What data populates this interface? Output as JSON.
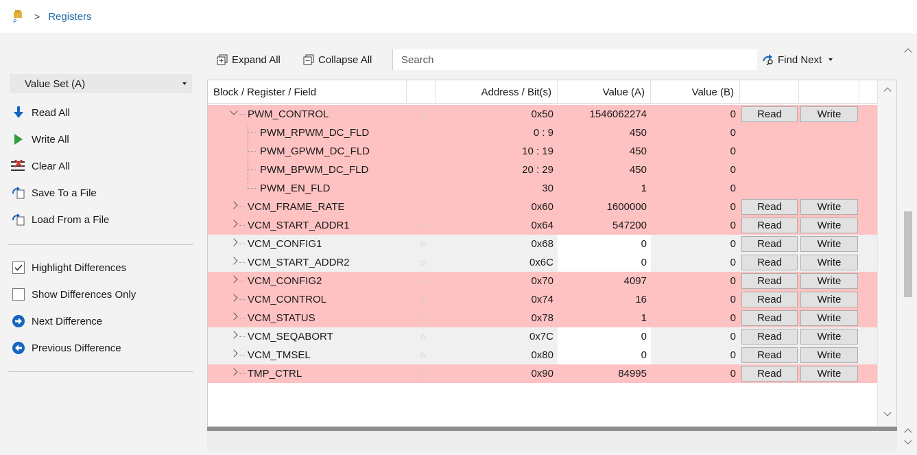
{
  "breadcrumb": {
    "label": "Registers"
  },
  "left_panel": {
    "value_set": "Value Set (A)",
    "actions": [
      {
        "label": "Read All",
        "icon": "arrow-down-icon"
      },
      {
        "label": "Write All",
        "icon": "play-icon"
      },
      {
        "label": "Clear All",
        "icon": "clear-list-icon"
      },
      {
        "label": "Save To a File",
        "icon": "save-file-icon"
      },
      {
        "label": "Load From a File",
        "icon": "load-file-icon"
      }
    ],
    "options": [
      {
        "label": "Highlight Differences",
        "checked": true
      },
      {
        "label": "Show Differences Only",
        "checked": false
      }
    ],
    "nav": [
      {
        "label": "Next Difference",
        "icon": "arrow-right-circle-icon"
      },
      {
        "label": "Previous Difference",
        "icon": "arrow-left-circle-icon"
      }
    ]
  },
  "toolbar": {
    "expand_all": "Expand All",
    "collapse_all": "Collapse All",
    "search_placeholder": "Search",
    "find_next": "Find Next"
  },
  "table": {
    "headers": [
      "Block / Register / Field",
      "",
      "Address / Bit(s)",
      "Value (A)",
      "Value (B)",
      "",
      ""
    ],
    "rows": [
      {
        "name": "PWM_CONTROL",
        "level": 0,
        "expanded": true,
        "star": true,
        "addr": "0x50",
        "va": "1546062274",
        "vb": "0",
        "diff": true,
        "buttons": true
      },
      {
        "name": "PWM_RPWM_DC_FLD",
        "level": 1,
        "star": false,
        "addr": "0 : 9",
        "va": "450",
        "vb": "0",
        "diff": true,
        "buttons": false
      },
      {
        "name": "PWM_GPWM_DC_FLD",
        "level": 1,
        "star": false,
        "addr": "10 : 19",
        "va": "450",
        "vb": "0",
        "diff": true,
        "buttons": false
      },
      {
        "name": "PWM_BPWM_DC_FLD",
        "level": 1,
        "star": false,
        "addr": "20 : 29",
        "va": "450",
        "vb": "0",
        "diff": true,
        "buttons": false
      },
      {
        "name": "PWM_EN_FLD",
        "level": 1,
        "last": true,
        "star": false,
        "addr": "30",
        "va": "1",
        "vb": "0",
        "diff": true,
        "buttons": false
      },
      {
        "name": "VCM_FRAME_RATE",
        "level": 0,
        "star": true,
        "addr": "0x60",
        "va": "1600000",
        "vb": "0",
        "diff": true,
        "buttons": true
      },
      {
        "name": "VCM_START_ADDR1",
        "level": 0,
        "star": true,
        "addr": "0x64",
        "va": "547200",
        "vb": "0",
        "diff": true,
        "buttons": true
      },
      {
        "name": "VCM_CONFIG1",
        "level": 0,
        "star": true,
        "addr": "0x68",
        "va": "0",
        "vb": "0",
        "diff": false,
        "buttons": true
      },
      {
        "name": "VCM_START_ADDR2",
        "level": 0,
        "star": true,
        "addr": "0x6C",
        "va": "0",
        "vb": "0",
        "diff": false,
        "buttons": true
      },
      {
        "name": "VCM_CONFIG2",
        "level": 0,
        "star": true,
        "addr": "0x70",
        "va": "4097",
        "vb": "0",
        "diff": true,
        "buttons": true
      },
      {
        "name": "VCM_CONTROL",
        "level": 0,
        "star": true,
        "addr": "0x74",
        "va": "16",
        "vb": "0",
        "diff": true,
        "buttons": true
      },
      {
        "name": "VCM_STATUS",
        "level": 0,
        "star": true,
        "addr": "0x78",
        "va": "1",
        "vb": "0",
        "diff": true,
        "buttons": true
      },
      {
        "name": "VCM_SEQABORT",
        "level": 0,
        "star": true,
        "addr": "0x7C",
        "va": "0",
        "vb": "0",
        "diff": false,
        "buttons": true
      },
      {
        "name": "VCM_TMSEL",
        "level": 0,
        "star": true,
        "addr": "0x80",
        "va": "0",
        "vb": "0",
        "diff": false,
        "buttons": true
      },
      {
        "name": "TMP_CTRL",
        "level": 0,
        "star": true,
        "addr": "0x90",
        "va": "84995",
        "vb": "0",
        "diff": true,
        "buttons": true
      }
    ],
    "read_label": "Read",
    "write_label": "Write"
  },
  "colors": {
    "diff_row": "#ffc2c2",
    "accent": "#1565c0"
  }
}
